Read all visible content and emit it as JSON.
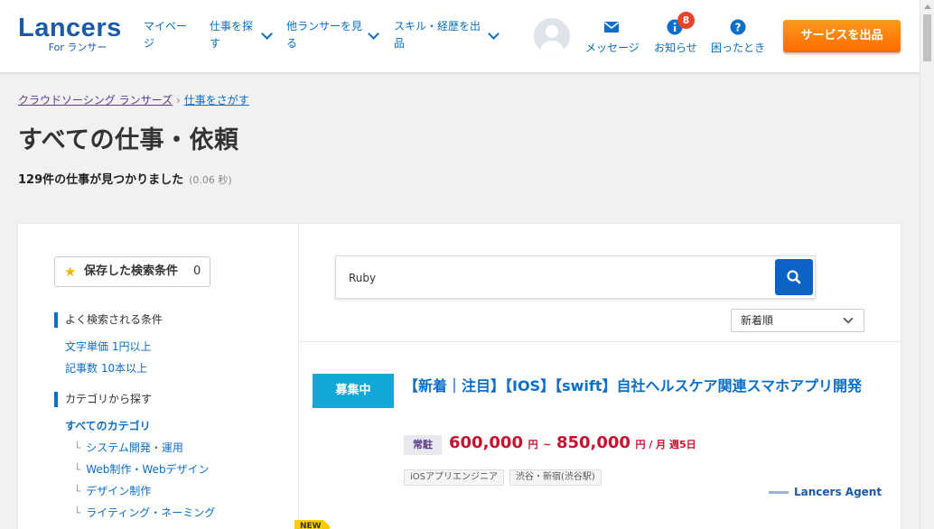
{
  "logo": {
    "main": "Lancers",
    "sub": "For ランサー"
  },
  "nav": [
    {
      "label": "マイペー\nジ"
    },
    {
      "label": "仕事を探\nす"
    },
    {
      "label": "他ランサーを見\nる"
    },
    {
      "label": "スキル・経歴を出\n品"
    }
  ],
  "header_actions": {
    "messages": "メッセージ",
    "notifications": "お知らせ",
    "notification_count": "8",
    "help": "困ったとき",
    "cta": "サービスを出品"
  },
  "breadcrumb": {
    "first": "クラウドソーシング ランサーズ",
    "second": "仕事をさがす"
  },
  "page_title": "すべての仕事・依頼",
  "result": {
    "text": "129件の仕事が見つかりました",
    "time": "(0.06 秒)"
  },
  "sidebar": {
    "saved_label": "保存した検索条件",
    "saved_count": "0",
    "popular_head": "よく検索される条件",
    "popular": [
      "文字単価 1円以上",
      "記事数 10本以上"
    ],
    "category_head": "カテゴリから探す",
    "all_categories": "すべてのカテゴリ",
    "categories": [
      "システム開発・運用",
      "Web制作・Webデザイン",
      "デザイン制作",
      "ライティング・ネーミング"
    ]
  },
  "search": {
    "value": "Ruby"
  },
  "sort": {
    "selected": "新着順"
  },
  "job": {
    "status": "募集中",
    "title": "【新着｜注目】【IOS】【swift】自社ヘルスケア関連スマホアプリ開発",
    "employment": "常駐",
    "price_low": "600,000",
    "price_high": "850,000",
    "unit1": "円",
    "tilde": "~",
    "unit2": "円 / 月 週5日",
    "tags": [
      "iOSアプリエンジニア",
      "渋谷・新宿(渋谷駅)"
    ],
    "agent": "Lancers Agent"
  },
  "next_badge": "NEW",
  "colors": {
    "brand": "#1a5aa6",
    "link": "#0b6ec8",
    "cta": "#ff7a00",
    "status": "#11a8d8",
    "price": "#c8102e"
  }
}
